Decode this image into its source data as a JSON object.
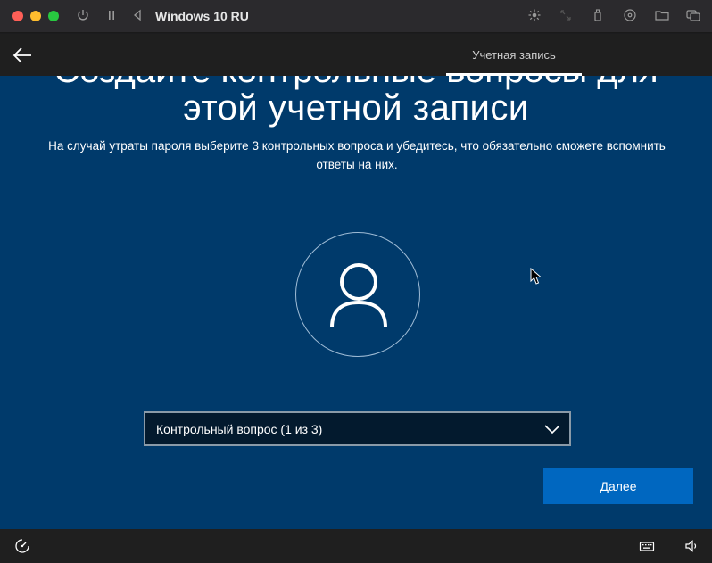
{
  "window": {
    "title": "Windows 10 RU"
  },
  "oobe": {
    "tab_label": "Учетная запись",
    "heading_ghost": "Создайте контрольные вопросы для",
    "heading": "этой учетной записи",
    "description": "На случай утраты пароля выберите 3 контрольных вопроса и убедитесь, что обязательно сможете вспомнить ответы на них.",
    "dropdown_value": "Контрольный вопрос (1 из 3)",
    "next_label": "Далее"
  },
  "colors": {
    "background": "#003a6b",
    "accent": "#0067c0",
    "dropdown_bg": "#031a2e"
  },
  "icons": {
    "titlebar": [
      "power-icon",
      "pause-icon",
      "back-triangle-icon"
    ],
    "titlebar_right": [
      "brightness-icon",
      "resize-icon",
      "usb-icon",
      "disc-icon",
      "folder-icon",
      "windows-icon"
    ],
    "bottom": [
      "ease-of-access-icon",
      "keyboard-icon",
      "volume-icon"
    ]
  }
}
